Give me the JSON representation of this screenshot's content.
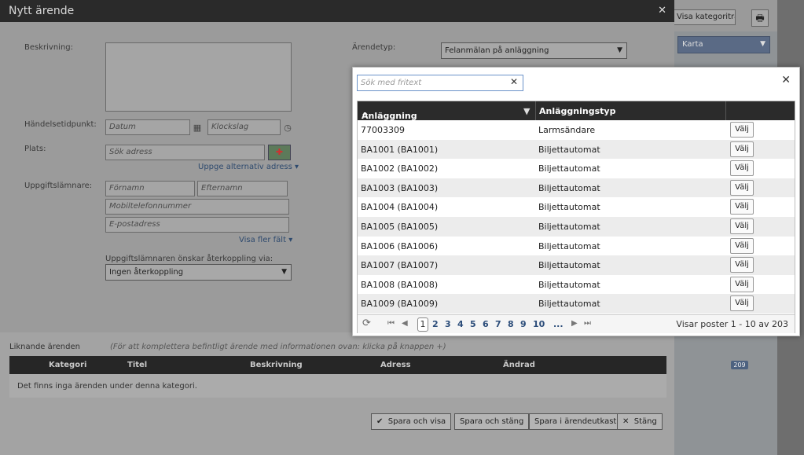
{
  "background": {
    "category_tree_label": "Visa kategoriträd",
    "map_select_value": "Karta",
    "road_badge": "209"
  },
  "dialog": {
    "title": "Nytt ärende",
    "labels": {
      "description": "Beskrivning:",
      "event_time": "Händelsetidpunkt:",
      "place": "Plats:",
      "reporter": "Uppgiftslämnare:",
      "case_type": "Ärendetyp:",
      "feedback": "Uppgiftslämnaren önskar återkoppling via:"
    },
    "placeholders": {
      "date": "Datum",
      "time": "Klockslag",
      "address": "Sök adress",
      "firstname": "Förnamn",
      "lastname": "Efternamn",
      "mobile": "Mobiltelefonnummer",
      "email": "E-postadress"
    },
    "case_type_value": "Felanmälan på anläggning",
    "feedback_value": "Ingen återkoppling",
    "alt_address_link": "Uppge alternativ adress",
    "more_fields_link": "Visa fler fält",
    "similar": {
      "title": "Liknande ärenden",
      "hint": "(För att komplettera befintligt ärende med informationen ovan: klicka på knappen +)",
      "columns": [
        "Kategori",
        "Titel",
        "Beskrivning",
        "Adress",
        "Ändrad"
      ],
      "empty": "Det finns inga ärenden under denna kategori."
    },
    "buttons": {
      "save_view": "Spara och visa",
      "save_close": "Spara och stäng",
      "save_draft": "Spara i ärendeutkast",
      "close": "Stäng"
    }
  },
  "picker": {
    "search_placeholder": "Sök med fritext",
    "columns": {
      "facility": "Anläggning",
      "type": "Anläggningstyp"
    },
    "choose_label": "Välj",
    "rows": [
      {
        "facility": "77003309",
        "type": "Larmsändare"
      },
      {
        "facility": "BA1001 (BA1001)",
        "type": "Biljettautomat"
      },
      {
        "facility": "BA1002 (BA1002)",
        "type": "Biljettautomat"
      },
      {
        "facility": "BA1003 (BA1003)",
        "type": "Biljettautomat"
      },
      {
        "facility": "BA1004 (BA1004)",
        "type": "Biljettautomat"
      },
      {
        "facility": "BA1005 (BA1005)",
        "type": "Biljettautomat"
      },
      {
        "facility": "BA1006 (BA1006)",
        "type": "Biljettautomat"
      },
      {
        "facility": "BA1007 (BA1007)",
        "type": "Biljettautomat"
      },
      {
        "facility": "BA1008 (BA1008)",
        "type": "Biljettautomat"
      },
      {
        "facility": "BA1009 (BA1009)",
        "type": "Biljettautomat"
      }
    ],
    "pager": {
      "current": "1",
      "pages": [
        "2",
        "3",
        "4",
        "5",
        "6",
        "7",
        "8",
        "9",
        "10",
        "..."
      ],
      "info": "Visar poster 1 - 10 av 203"
    }
  }
}
